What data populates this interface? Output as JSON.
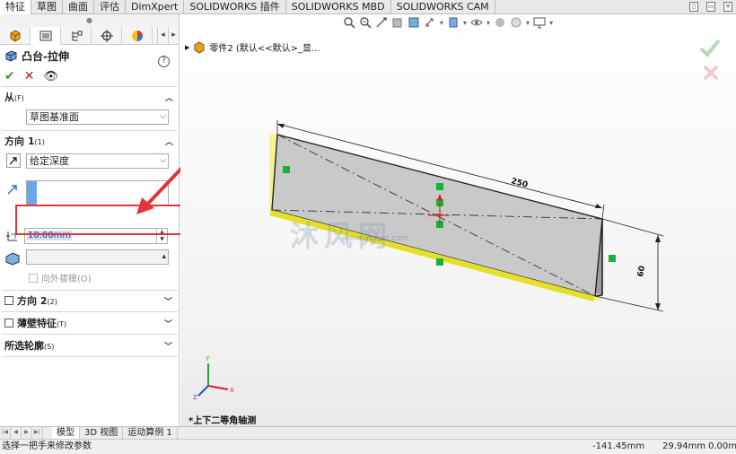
{
  "command_tabs": [
    "特征",
    "草图",
    "曲面",
    "评估",
    "DimXpert",
    "SOLIDWORKS 插件",
    "SOLIDWORKS MBD",
    "SOLIDWORKS CAM"
  ],
  "active_tab": "特征",
  "feature": {
    "title": "凸台-拉伸",
    "from": {
      "label": "从",
      "hotkey": "(F)",
      "value": "草图基准面"
    },
    "direction1": {
      "label": "方向 1",
      "hotkey": "(1)",
      "end_condition": "给定深度",
      "depth": "10.00mm",
      "draft_outward": "向外拔模",
      "draft_outward_hotkey": "(O)"
    },
    "direction2": {
      "label": "方向 2",
      "hotkey": "(2)"
    },
    "thin_feature": {
      "label": "薄壁特征",
      "hotkey": "(T)"
    },
    "selected_contours": {
      "label": "所选轮廓",
      "hotkey": "(S)"
    }
  },
  "tree_path": "零件2 (默认<<默认>_显...",
  "dimensions": {
    "length": "250",
    "height": "60"
  },
  "view_label": "*上下二等角轴测",
  "triad": {
    "x": "X",
    "y": "Y",
    "z": "Z"
  },
  "watermark": "沐风网",
  "watermark_url": "www.mfcad.com",
  "bottom_tabs": [
    "模型",
    "3D 视图",
    "运动算例 1"
  ],
  "active_bottom_tab": "模型",
  "status": {
    "message": "选择一把手来修改参数",
    "x": "-141.45mm",
    "y": "29.94mm",
    "z": "0.00mm"
  },
  "colors": {
    "accent_red": "#e0353a",
    "highlight_yellow": "#f6ee3a",
    "face_gray": "#c8c8c8",
    "handle_green": "#18b23a"
  }
}
